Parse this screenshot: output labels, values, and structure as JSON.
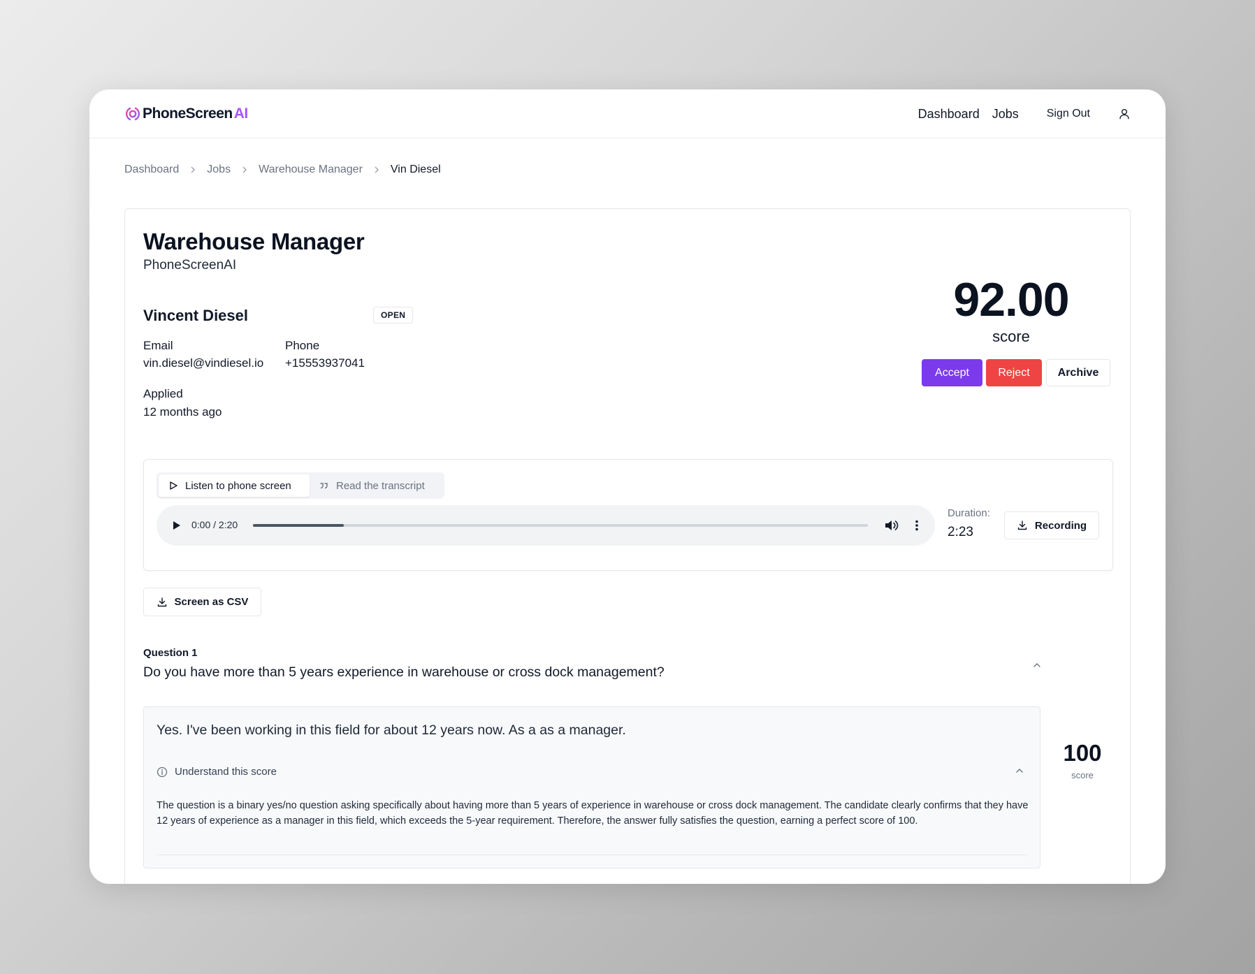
{
  "header": {
    "logo_text": "PhoneScreen",
    "logo_ai": "AI",
    "nav": {
      "dashboard": "Dashboard",
      "jobs": "Jobs",
      "sign_out": "Sign Out"
    }
  },
  "breadcrumb": [
    "Dashboard",
    "Jobs",
    "Warehouse Manager",
    "Vin Diesel"
  ],
  "job": {
    "title": "Warehouse Manager",
    "company": "PhoneScreenAI"
  },
  "candidate": {
    "name": "Vincent Diesel",
    "status": "OPEN",
    "email_label": "Email",
    "email": "vin.diesel@vindiesel.io",
    "phone_label": "Phone",
    "phone": "+15553937041",
    "applied_label": "Applied",
    "applied": "12 months ago"
  },
  "score": {
    "value": "92.00",
    "label": "score"
  },
  "actions": {
    "accept": "Accept",
    "reject": "Reject",
    "archive": "Archive"
  },
  "audio": {
    "tab_listen": "Listen to phone screen",
    "tab_transcript": "Read the transcript",
    "time": "0:00 / 2:20",
    "progress_fraction": 0.148,
    "duration_label": "Duration:",
    "duration": "2:23",
    "recording_button": "Recording"
  },
  "csv_button": "Screen as CSV",
  "question": {
    "label": "Question 1",
    "text": "Do you have more than 5 years experience in warehouse or cross dock management?",
    "answer": "Yes. I've been working in this field for about 12 years now. As a as a manager.",
    "understand_label": "Understand this score",
    "explanation": "The question is a binary yes/no question asking specifically about having more than 5 years of experience in warehouse or cross dock management. The candidate clearly confirms that they have 12 years of experience as a manager in this field, which exceeds the 5-year requirement. Therefore, the answer fully satisfies the question, earning a perfect score of 100.",
    "score": "100",
    "score_label": "score"
  },
  "colors": {
    "accent": "#7c3aed",
    "danger": "#ef4444",
    "logo_ai": "#a855f7"
  },
  "icons": [
    "logo-mark-icon",
    "user-icon",
    "chevron-right-icon",
    "play-outline-icon",
    "quote-icon",
    "play-icon",
    "volume-icon",
    "more-vertical-icon",
    "download-icon",
    "chevron-up-icon",
    "info-icon"
  ]
}
